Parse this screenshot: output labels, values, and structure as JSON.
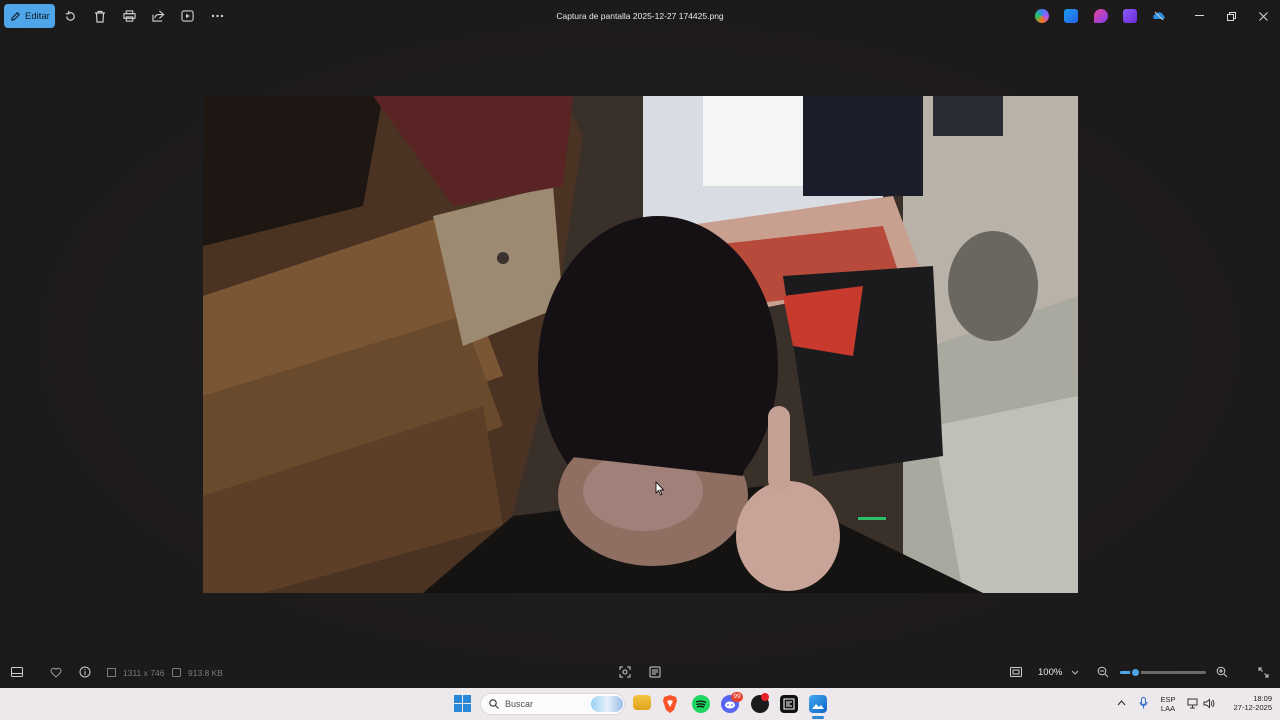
{
  "window": {
    "title": "Captura de pantalla 2025-12-27 174425.png",
    "edit_label": "Editar"
  },
  "toolbar_icons": [
    "rotate-icon",
    "delete-icon",
    "print-icon",
    "share-icon",
    "slideshow-icon",
    "more-icon"
  ],
  "title_app_icons": [
    "copilot-icon",
    "photo-editor-icon",
    "designer-icon",
    "clipchamp-icon",
    "onedrive-icon"
  ],
  "window_controls": [
    "minimize-icon",
    "maximize-icon",
    "close-icon"
  ],
  "image_info": {
    "dimensions": "1311 x 746",
    "file_size": "913.8 KB"
  },
  "zoom": {
    "level_label": "100%",
    "slider_fraction": 0.17
  },
  "taskbar": {
    "search_placeholder": "Buscar",
    "language_top": "ESP",
    "language_bottom": "LAA",
    "time": "18:09",
    "date": "27-12-2025",
    "notification_badge": "99"
  },
  "colors": {
    "accent": "#4ea6e8",
    "background": "#1e1b1c",
    "taskbar": "#ece8ec"
  }
}
